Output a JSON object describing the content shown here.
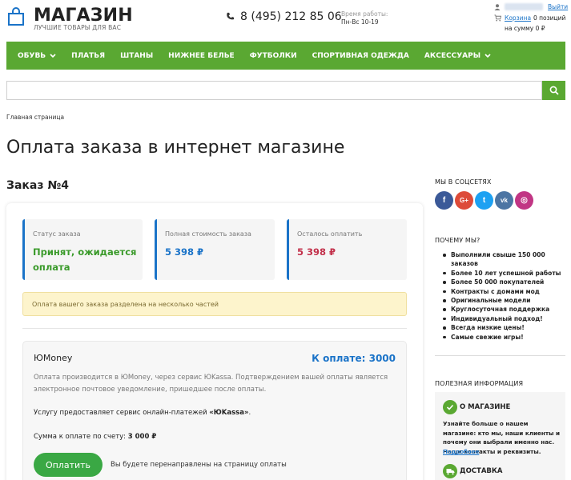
{
  "header": {
    "logo_title": "МАГАЗИН",
    "logo_subtitle": "ЛУЧШИЕ ТОВАРЫ ДЛЯ ВАС",
    "phone": "8 (495) 212 85 06",
    "hours_label": "Время работы:",
    "hours_value": "Пн-Вс 10-19",
    "logout": "Выйти",
    "cart_link": "Корзина",
    "cart_count": "0 позиций",
    "cart_sum": "на сумму 0 ₽"
  },
  "nav": {
    "items": [
      {
        "label": "ОБУВЬ",
        "dropdown": true
      },
      {
        "label": "ПЛАТЬЯ",
        "dropdown": false
      },
      {
        "label": "ШТАНЫ",
        "dropdown": false
      },
      {
        "label": "НИЖНЕЕ БЕЛЬЕ",
        "dropdown": false
      },
      {
        "label": "ФУТБОЛКИ",
        "dropdown": false
      },
      {
        "label": "СПОРТИВНАЯ ОДЕЖДА",
        "dropdown": false
      },
      {
        "label": "АКСЕССУАРЫ",
        "dropdown": true
      }
    ]
  },
  "search": {
    "value": "",
    "placeholder": ""
  },
  "breadcrumb": "Главная страница",
  "page_title": "Оплата заказа в интернет магазине",
  "order": {
    "title": "Заказ №4",
    "status_label": "Статус заказа",
    "status_value": "Принят, ожидается оплата",
    "total_label": "Полная стоимость заказа",
    "total_value": "5 398 ₽",
    "remaining_label": "Осталось оплатить",
    "remaining_value": "5 398 ₽",
    "notice": "Оплата вашего заказа разделена на несколько частей"
  },
  "payment": {
    "name": "ЮMoney",
    "amount": "К оплате: 3000",
    "description": "Оплата производится в ЮMoney, через сервис ЮKassa. Подтверждением вашей оплаты является электронное почтовое уведомление, пришедшее после оплаты.",
    "service_prefix": "Услугу предоставляет сервис онлайн-платежей ",
    "service_name": "«ЮKassa»",
    "service_suffix": ".",
    "total_prefix": "Сумма к оплате по счету: ",
    "total_value": "3 000 ₽",
    "button": "Оплатить",
    "redirect": "Вы будете перенаправлены на страницу оплаты"
  },
  "sidebar": {
    "social_heading": "МЫ В СОЦСЕТЯХ",
    "social": [
      {
        "name": "facebook",
        "glyph": "f",
        "color": "#3b5998"
      },
      {
        "name": "google-plus",
        "glyph": "G+",
        "color": "#dd4b39"
      },
      {
        "name": "twitter",
        "glyph": "t",
        "color": "#1da1f2"
      },
      {
        "name": "vk",
        "glyph": "vk",
        "color": "#4c75a3"
      },
      {
        "name": "instagram",
        "glyph": "◎",
        "color": "#c13584"
      }
    ],
    "why_heading": "ПОЧЕМУ МЫ?",
    "why_items": [
      "Выполнили свыше 150 000 заказов",
      "Более 10 лет успешной работы",
      "Более 50 000 покупателей",
      "Контракты с домами мод",
      "Оригинальные модели",
      "Круглосуточная поддержка",
      "Индивидуальный подход!",
      "Всегда низкие цены!",
      "Самые свежие игры!"
    ],
    "info_heading": "ПОЛЕЗНАЯ ИНФОРМАЦИЯ",
    "about_title": "О МАГАЗИНЕ",
    "about_text": "Узнайте больше о нашем магазине: кто мы, наши клиенты и почему они выбрали именно нас. Наши контакты и реквизиты.",
    "about_more": "Подробнее",
    "delivery_title": "ДОСТАВКА"
  },
  "colors": {
    "brand_green": "#5aa832",
    "accent_blue": "#1a73c8",
    "status_green": "#3a9a2a",
    "remaining_red": "#c2304a"
  }
}
